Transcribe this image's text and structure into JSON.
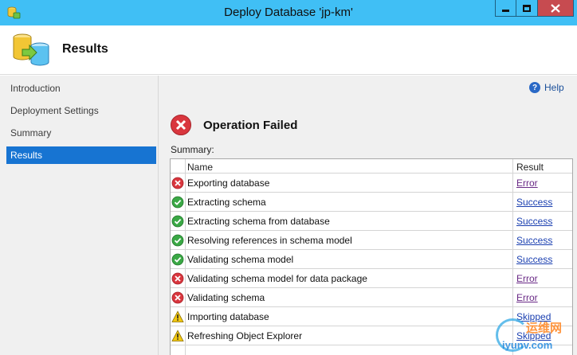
{
  "window": {
    "title": "Deploy Database 'jp-km'",
    "icon": "database-wizard-icon",
    "controls": [
      "minimize-icon",
      "maximize-icon",
      "close-icon"
    ]
  },
  "header": {
    "title": "Results",
    "icon": "database-deploy-icon"
  },
  "sidebar": {
    "items": [
      {
        "label": "Introduction",
        "active": false
      },
      {
        "label": "Deployment Settings",
        "active": false
      },
      {
        "label": "Summary",
        "active": false
      },
      {
        "label": "Results",
        "active": true
      }
    ]
  },
  "main": {
    "help_label": "Help",
    "status_text": "Operation Failed",
    "status_icon": "error-icon",
    "summary_label": "Summary:",
    "table": {
      "columns": [
        "Name",
        "Result"
      ],
      "rows": [
        {
          "icon": "error",
          "name": "Exporting database",
          "result": "Error"
        },
        {
          "icon": "success",
          "name": "Extracting schema",
          "result": "Success"
        },
        {
          "icon": "success",
          "name": "Extracting schema from database",
          "result": "Success"
        },
        {
          "icon": "success",
          "name": "Resolving references in schema model",
          "result": "Success"
        },
        {
          "icon": "success",
          "name": "Validating schema model",
          "result": "Success"
        },
        {
          "icon": "error",
          "name": "Validating schema model for data package",
          "result": "Error"
        },
        {
          "icon": "error",
          "name": "Validating schema",
          "result": "Error"
        },
        {
          "icon": "warning",
          "name": "Importing database",
          "result": "Skipped"
        },
        {
          "icon": "warning",
          "name": "Refreshing Object Explorer",
          "result": "Skipped"
        }
      ]
    }
  },
  "watermark": {
    "brand": "运维网",
    "url": "iyunv.com"
  },
  "colors": {
    "titlebar": "#40bff5",
    "close_button": "#c74b50",
    "selection": "#1774d2",
    "error": "#d9363e",
    "success": "#3aa845",
    "warning": "#f2c811",
    "link": "#1a3fb0"
  }
}
